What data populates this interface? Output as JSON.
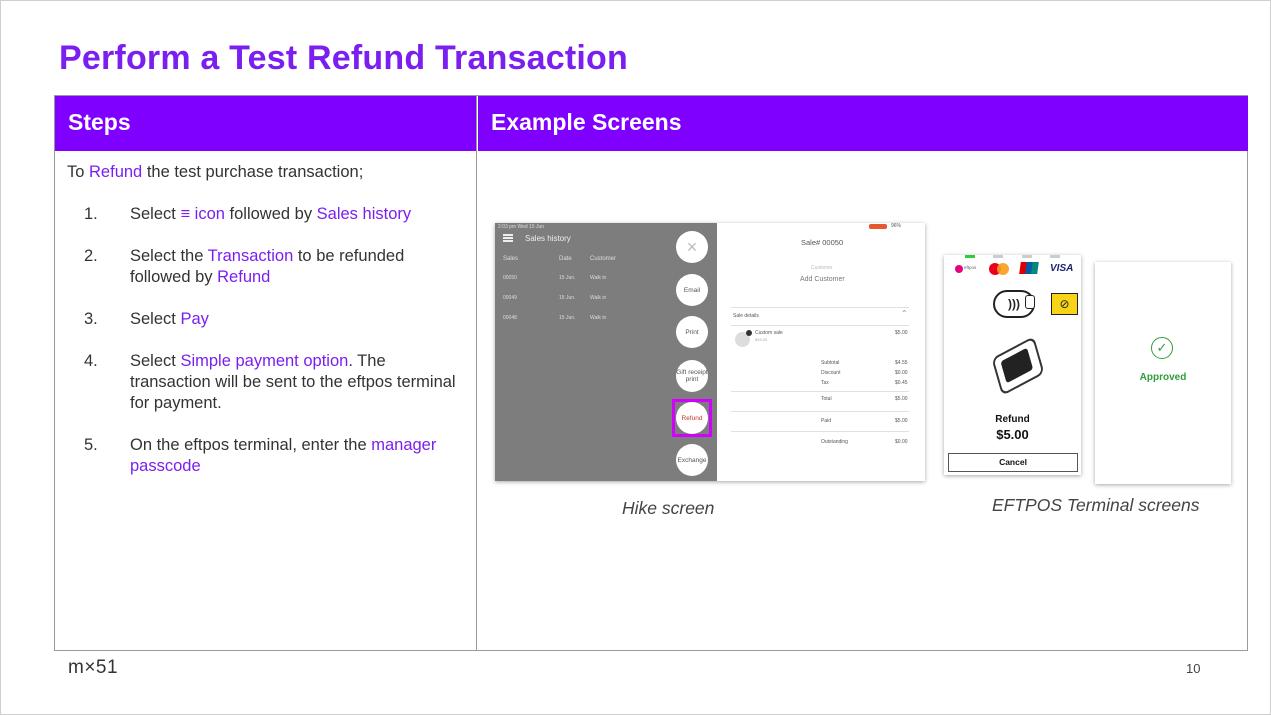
{
  "title": "Perform a Test Refund Transaction",
  "columns": {
    "steps": "Steps",
    "examples": "Example Screens"
  },
  "intro": {
    "pre": "To ",
    "highlight": "Refund",
    "post": " the test purchase transaction;"
  },
  "steps": [
    {
      "num": "1.",
      "parts": [
        {
          "t": "Select "
        },
        {
          "t": "≡ icon",
          "hl": true
        },
        {
          "t": " followed by "
        },
        {
          "t": "Sales history",
          "hl": true
        }
      ]
    },
    {
      "num": "2.",
      "parts": [
        {
          "t": "Select the "
        },
        {
          "t": "Transaction",
          "hl": true
        },
        {
          "t": " to be refunded followed by "
        },
        {
          "t": "Refund",
          "hl": true
        }
      ]
    },
    {
      "num": "3.",
      "parts": [
        {
          "t": "Select "
        },
        {
          "t": "Pay",
          "hl": true
        }
      ]
    },
    {
      "num": "4.",
      "parts": [
        {
          "t": "Select "
        },
        {
          "t": "Simple payment option",
          "hl": true
        },
        {
          "t": ". The transaction will be sent to the eftpos terminal for payment."
        }
      ]
    },
    {
      "num": "5.",
      "parts": [
        {
          "t": "On the eftpos terminal, enter the "
        },
        {
          "t": "manager passcode",
          "hl": true
        }
      ]
    }
  ],
  "hike": {
    "status_time": "2:03 pm  Wed 15 Jun",
    "battery": "96%",
    "list_title": "Sales history",
    "headers": [
      "Sales",
      "Date",
      "Customer"
    ],
    "rows": [
      [
        "00050",
        "15 Jun.",
        "Walk in"
      ],
      [
        "00049",
        "15 Jun.",
        "Walk in"
      ],
      [
        "00048",
        "15 Jun.",
        "Walk in"
      ]
    ],
    "actions": [
      "Email",
      "Print",
      "Gift receipt print",
      "Refund",
      "Exchange"
    ],
    "sale_title": "Sale# 00050",
    "customer_label": "Customer",
    "add_customer": "Add Customer",
    "sale_details": "Sale details",
    "item_name": "Custom sale",
    "item_sub": "$45.00",
    "item_price": "$5.00",
    "totals": [
      [
        "Subtotal",
        "$4.55"
      ],
      [
        "Discount",
        "$0.00"
      ],
      [
        "Tax",
        "$0.45"
      ],
      [
        "Total",
        "$5.00"
      ],
      [
        "Paid",
        "$5.00"
      ],
      [
        "Outstanding",
        "$0.00"
      ]
    ]
  },
  "terminal": {
    "brand_small": "eftpos",
    "visa": "VISA",
    "refund_label": "Refund",
    "amount": "$5.00",
    "cancel": "Cancel",
    "approved": "Approved",
    "colors": {
      "approved_green": "#2e9e3a",
      "mastercard_red": "#eb001b",
      "mastercard_orange": "#f79e1b",
      "visa_blue": "#1a1f71"
    }
  },
  "captions": {
    "hike": "Hike screen",
    "terminal": "EFTPOS Terminal screens"
  },
  "footer": {
    "logo": "m×51",
    "page": "10"
  },
  "colors": {
    "accent": "#7b1ef0",
    "header_bg": "#8000ff",
    "refund_highlight": "#d400ff"
  }
}
